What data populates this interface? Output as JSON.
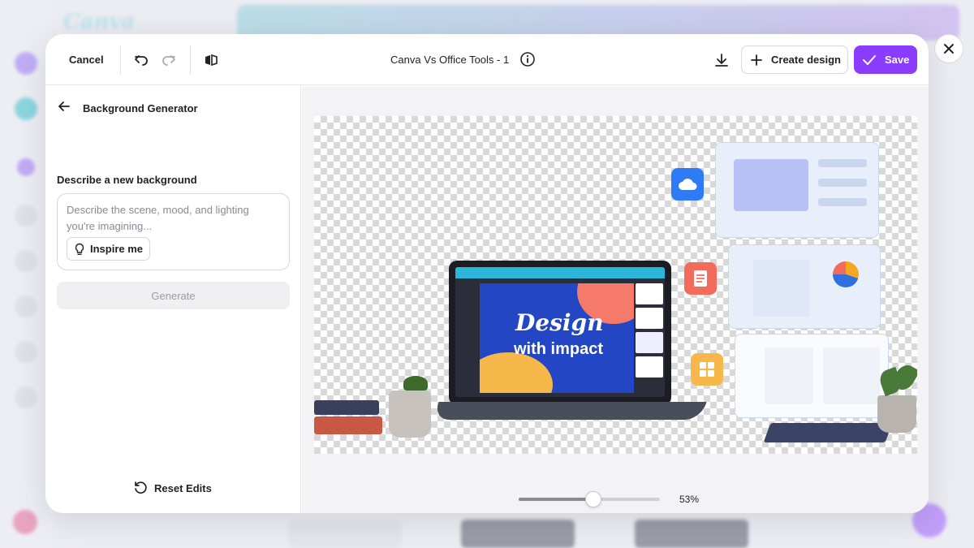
{
  "header": {
    "cancel_label": "Cancel",
    "document_title": "Canva Vs Office Tools - 1",
    "create_design_label": "Create design",
    "save_label": "Save"
  },
  "panel": {
    "title": "Background Generator",
    "describe_label": "Describe a new background",
    "describe_placeholder": "Describe the scene, mood, and lighting you're imagining...",
    "describe_value": "",
    "inspire_label": "Inspire me",
    "generate_label": "Generate",
    "reset_label": "Reset Edits"
  },
  "canvas": {
    "design_line1": "Design",
    "design_line2": "with impact"
  },
  "zoom": {
    "value_label": "53%",
    "level": 0.53
  },
  "icons": [
    "undo-icon",
    "redo-icon",
    "flip-icon",
    "info-icon",
    "download-icon",
    "plus-icon",
    "check-icon",
    "arrow-left-icon",
    "lightbulb-icon",
    "reset-icon",
    "close-icon"
  ],
  "colors": {
    "accent": "#8b3dff",
    "canvas_bg": "#f3f3f6"
  }
}
